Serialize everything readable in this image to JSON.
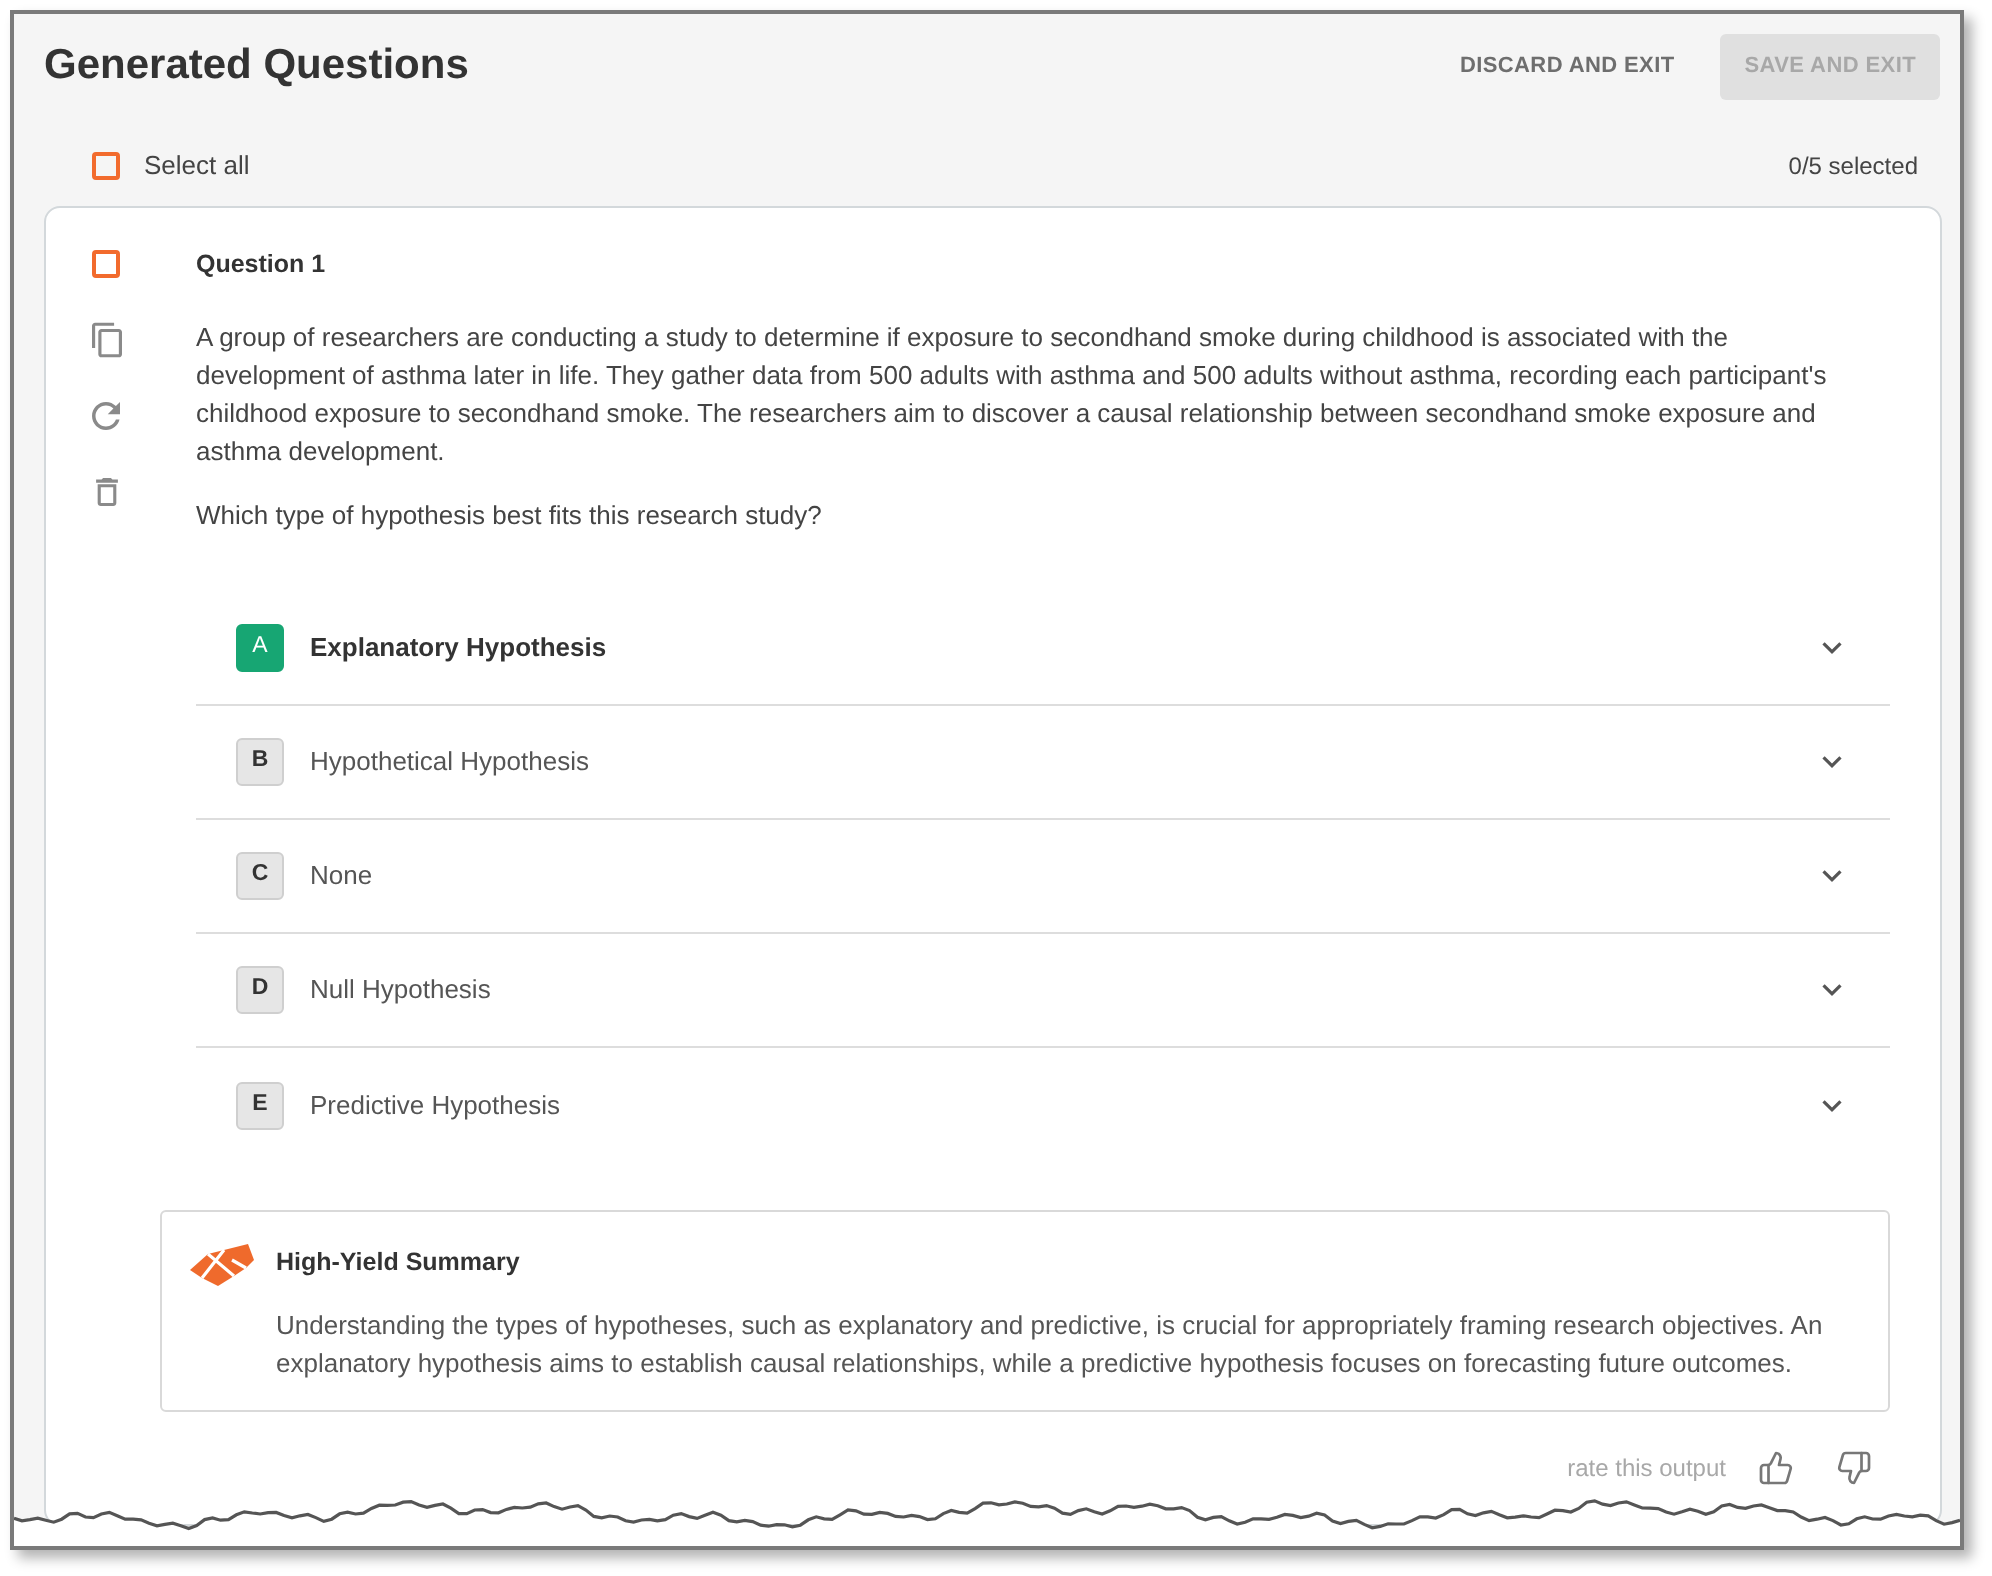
{
  "header": {
    "title": "Generated Questions",
    "buttons": [
      {
        "label": "DISCARD AND EXIT",
        "kind": "text",
        "disabled": false
      },
      {
        "label": "SAVE AND EXIT",
        "kind": "contained",
        "disabled": true
      }
    ]
  },
  "select_all": {
    "label": "Select all",
    "checked": false,
    "count": "0/5 selected"
  },
  "questions": [
    {
      "title": "Question 1",
      "checked": false,
      "stem": "A group of researchers are conducting a study to determine if exposure to secondhand smoke during childhood is associated with the development of asthma later in life. They gather data from 500 adults with asthma and 500 adults without asthma, recording each participant's childhood exposure to secondhand smoke. The researchers aim to discover a causal relationship between secondhand smoke exposure and asthma development.",
      "prompt": "Which type of hypothesis best fits this research study?",
      "options": [
        {
          "letter": "A",
          "text": "Explanatory Hypothesis",
          "selected": true
        },
        {
          "letter": "B",
          "text": "Hypothetical Hypothesis",
          "selected": false
        },
        {
          "letter": "C",
          "text": "None",
          "selected": false
        },
        {
          "letter": "D",
          "text": "Null Hypothesis",
          "selected": false
        },
        {
          "letter": "E",
          "text": "Predictive Hypothesis",
          "selected": false
        }
      ],
      "summary": {
        "title": "High-Yield Summary",
        "text": "Understanding the types of hypotheses, such as explanatory and predictive, is crucial for appropriately framing research objectives. An explanatory hypothesis aims to establish causal relationships, while a predictive hypothesis focuses on forecasting future outcomes."
      },
      "rating": {
        "label": "rate this output"
      }
    }
  ]
}
